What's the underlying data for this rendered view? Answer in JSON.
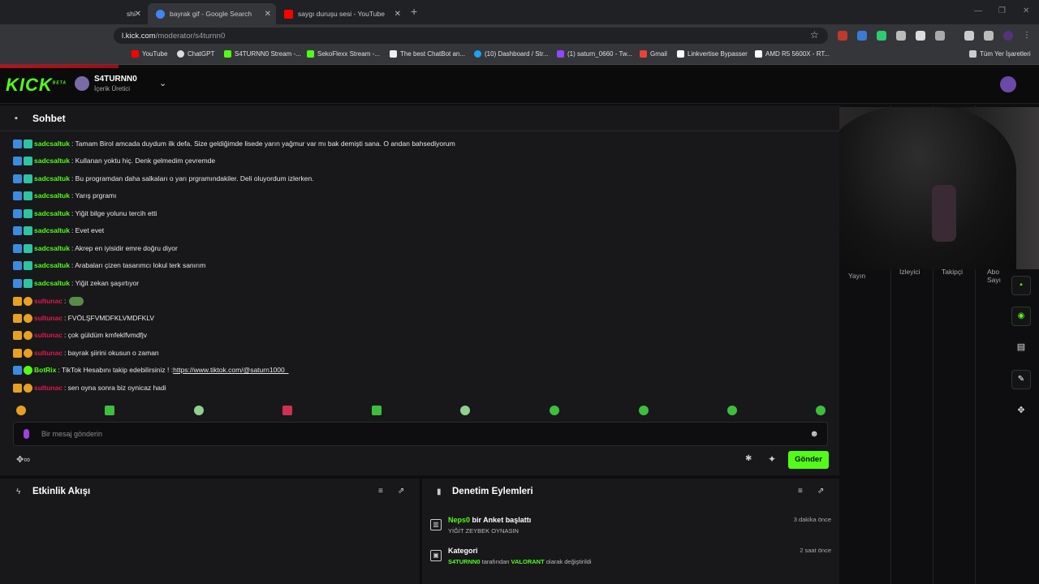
{
  "browser": {
    "tabs": [
      {
        "title": "shi"
      },
      {
        "title": "bayrak gif - Google Search"
      },
      {
        "title": "saygı duruşu sesi - YouTube"
      }
    ],
    "url_host": "l.kick.com",
    "url_path": "/moderator/s4turnn0",
    "bookmarks": [
      "YouTube",
      "ChatGPT",
      "S4TURNN0 Stream -...",
      "SekoFlexx Stream -...",
      "The best ChatBot an...",
      "(10) Dashboard / Str...",
      "(1) saturn_0660 - Tw...",
      "Gmail",
      "Linkvertise Bypasser",
      "AMD R5 5600X - RT..."
    ],
    "bookmarks_folder": "Tüm Yer İşaretleri"
  },
  "kick": {
    "logo": "KICK",
    "logo_tag": "BETA",
    "channel": "S4TURNN0",
    "role": "İçerik Üretici"
  },
  "chat": {
    "title": "Sohbet",
    "messages": [
      {
        "user": "sadcsaltuk",
        "text": ": Tamam Birol amcada duydum ilk defa. Size geldiğimde lisede yarın yağmur var mı bak demişti sana. O andan bahsediyorum"
      },
      {
        "user": "sadcsaltuk",
        "text": ": Kullanan yoktu hiç. Denk gelmedim çevremde"
      },
      {
        "user": "sadcsaltuk",
        "text": ": Bu programdan daha salkaları o yarı prgramındakiler. Deli oluyordum izlerken."
      },
      {
        "user": "sadcsaltuk",
        "text": ": Yarış prgramı"
      },
      {
        "user": "sadcsaltuk",
        "text": ": Yiğit bilge yolunu tercih etti"
      },
      {
        "user": "sadcsaltuk",
        "text": ": Evet evet"
      },
      {
        "user": "sadcsaltuk",
        "text": ": Akrep en iyisidir emre doğru diyor"
      },
      {
        "user": "sadcsaltuk",
        "text": ": Arabaları çizen tasarımcı lokul terk sanırım"
      },
      {
        "user": "sadcsaltuk",
        "text": ": Yiğit zekan şaşırtıyor"
      },
      {
        "user": "sultunac",
        "text": ":"
      },
      {
        "user": "sultunac",
        "text": ": FVÖLŞFVMDFKLVMDFKLV"
      },
      {
        "user": "sultunac",
        "text": ": çok güldüm kmfeklfvmdfjv"
      },
      {
        "user": "sultunac",
        "text": ": bayrak şiirini okusun o zaman"
      },
      {
        "user": "BotRix",
        "text": ": TikTok Hesabını takip edebilirsiniz ! : ",
        "link": "https://www.tiktok.com/@saturn1000_"
      },
      {
        "user": "sultunac",
        "text": ": sen oyna sonra biz oynicaz hadi"
      }
    ],
    "input_placeholder": "Bir mesaj gönderin",
    "send_label": "Gönder"
  },
  "stats": {
    "labels": [
      "Yayın",
      "İzleyici",
      "Takipçi",
      "Abo Sayı"
    ]
  },
  "activity": {
    "title": "Etkinlik Akışı"
  },
  "moderation": {
    "title": "Denetim Eylemleri",
    "rows": [
      {
        "actor": "Neps0",
        "action": " bir Anket başlattı",
        "detail": "YİĞİT ZEYBEK OYNASIN",
        "time": "3 dakika önce"
      },
      {
        "actor": "Kategori",
        "action": "",
        "detail_a": "S4TURNN0",
        "detail_b": " tarafından ",
        "detail_c": "VALORANT",
        "detail_d": " olarak değiştirildi",
        "time": "2 saat önce"
      }
    ]
  },
  "colors": {
    "kick_green": "#53fc18",
    "mod_name": "#53fc18",
    "sub_name": "#e0194a",
    "bg": "#18181b"
  }
}
